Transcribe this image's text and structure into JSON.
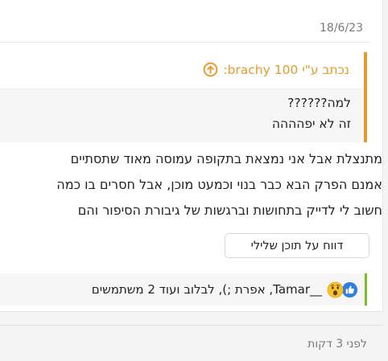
{
  "post": {
    "date": "18/6/23",
    "quote": {
      "author_line": "נכתב ע\"י brachy 100:",
      "lines": [
        "למה??????",
        "זה לא יפהההה"
      ],
      "accent_color": "#e49a2c"
    },
    "body_lines": [
      "מתנצלת אבל אני נמצאת בתקופה עמוסה מאוד שתסתיים",
      "אמנם הפרק הבא כבר בנוי וכמעט מוכן, אבל חסרים בו כמה",
      "חשוב לי לדייק בתחושות וברגשות של גיבורת הסיפור והם"
    ],
    "report_button": "דווח על תוכן שלילי",
    "reactions": {
      "text": "__Tamar, אפרת ;), לבלוב ועוד 2 משתמשים",
      "icons": [
        "like-icon",
        "wow-emoji-icon"
      ],
      "accent_color": "#7bbf28"
    }
  },
  "next_post": {
    "time": "לפני 3 דקות"
  }
}
